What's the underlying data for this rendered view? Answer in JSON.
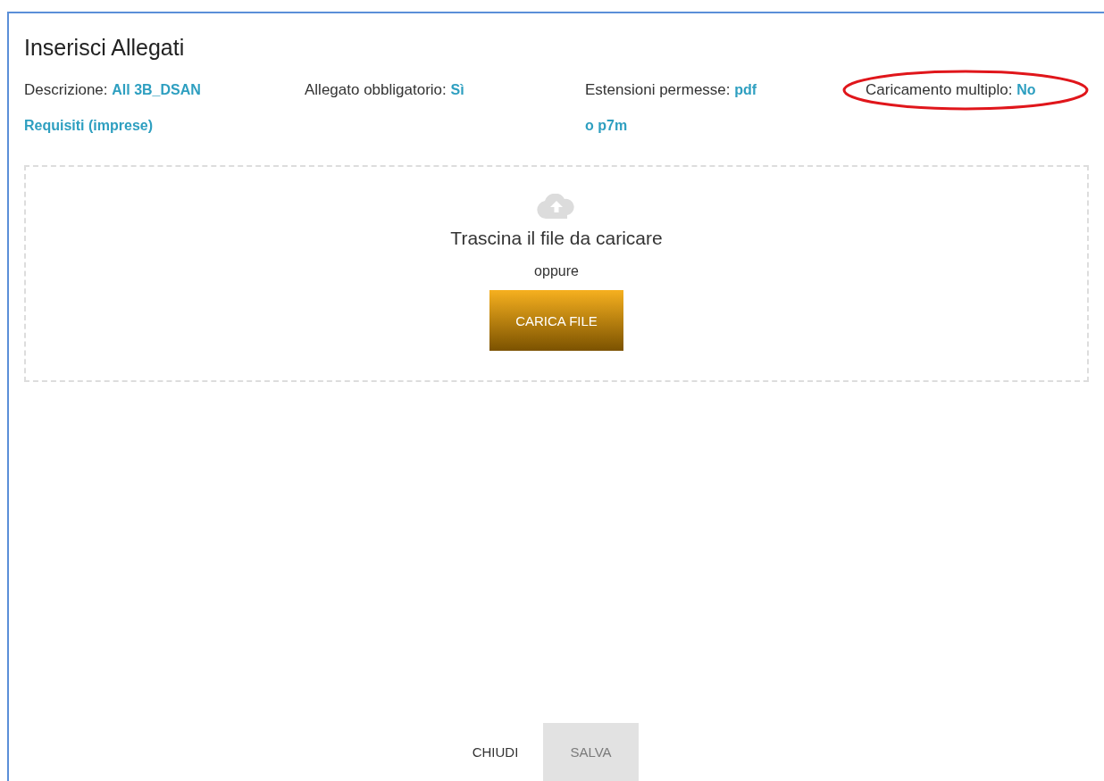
{
  "dialog": {
    "title": "Inserisci Allegati",
    "details": [
      {
        "label": "Descrizione:",
        "value": "All 3B_DSAN Requisiti (imprese)",
        "highlighted": false
      },
      {
        "label": "Allegato obbligatorio:",
        "value": "Sì",
        "highlighted": false
      },
      {
        "label": "Estensioni permesse:",
        "value": "pdf o p7m",
        "highlighted": false
      },
      {
        "label": "Caricamento multiplo:",
        "value": "No",
        "highlighted": true
      }
    ],
    "dropzone": {
      "prompt": "Trascina il file da caricare",
      "separator": "oppure",
      "button": "CARICA FILE"
    },
    "buttons": [
      {
        "label": "CHIUDI",
        "disabled": false
      },
      {
        "label": "SALVA",
        "disabled": true
      }
    ]
  }
}
